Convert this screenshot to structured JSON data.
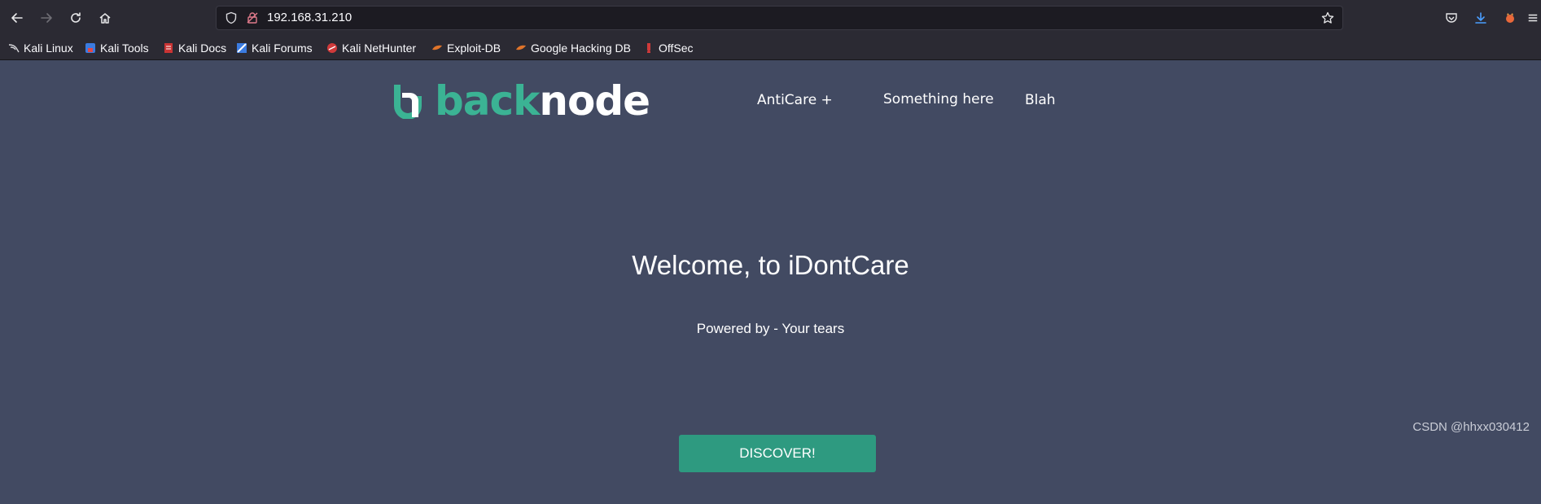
{
  "browser": {
    "url": "192.168.31.210",
    "bookmarks": [
      {
        "label": "Kali Linux",
        "icon": "kali-dragon-icon"
      },
      {
        "label": "Kali Tools",
        "icon": "kali-tools-icon"
      },
      {
        "label": "Kali Docs",
        "icon": "kali-docs-icon"
      },
      {
        "label": "Kali Forums",
        "icon": "kali-forums-icon"
      },
      {
        "label": "Kali NetHunter",
        "icon": "nethunter-icon"
      },
      {
        "label": "Exploit-DB",
        "icon": "exploit-db-icon"
      },
      {
        "label": "Google Hacking DB",
        "icon": "ghdb-icon"
      },
      {
        "label": "OffSec",
        "icon": "offsec-icon"
      }
    ]
  },
  "site": {
    "logo": {
      "part1": "back",
      "part2": "node",
      "color_accent": "#3bb394"
    },
    "nav": {
      "item1": "AntiCare +",
      "item2": "Something here",
      "item3": "Blah"
    },
    "hero": {
      "title": "Welcome, to iDontCare",
      "subtitle": "Powered by - Your tears",
      "button_label": "DISCOVER!"
    },
    "watermark": "CSDN @hhxx030412"
  },
  "colors": {
    "page_bg": "#424a62",
    "button_bg": "#2e9a80",
    "chrome_bg": "#2b2a33"
  }
}
